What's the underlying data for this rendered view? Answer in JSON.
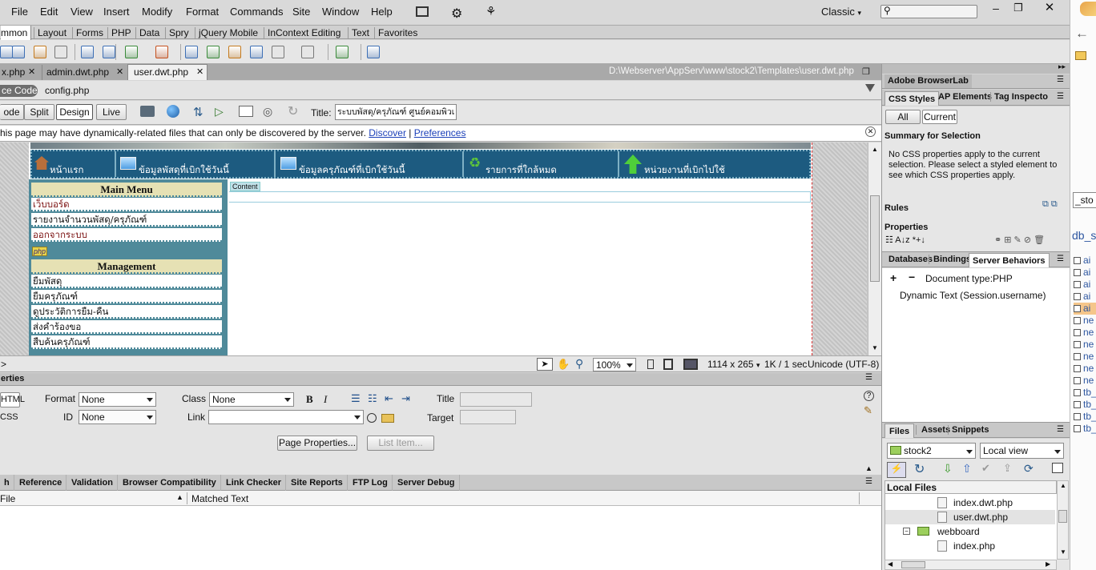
{
  "menu": [
    "File",
    "Edit",
    "View",
    "Insert",
    "Modify",
    "Format",
    "Commands",
    "Site",
    "Window",
    "Help"
  ],
  "workspace": "Classic",
  "search_placeholder": "",
  "insert_tabs": [
    "mmon",
    "Layout",
    "Forms",
    "PHP",
    "Data",
    "Spry",
    "jQuery Mobile",
    "InContext Editing",
    "Text",
    "Favorites"
  ],
  "doc_tabs": [
    "x.php",
    "admin.dwt.php",
    "user.dwt.php"
  ],
  "doc_path": "D:\\Webserver\\AppServ\\www\\stock2\\Templates\\user.dwt.php",
  "related": {
    "source_code": "ce Code",
    "file": "config.php"
  },
  "view_buttons": [
    "ode",
    "Split",
    "Design",
    "Live"
  ],
  "title_label": "Title:",
  "title_value": "ระบบพัสดุ/ครุภัณฑ์ ศูนย์คอมพิวเ",
  "info_bar": {
    "text": "his page may have dynamically-related files that can only be discovered by the server.",
    "discover": "Discover",
    "sep": "|",
    "preferences": "Preferences"
  },
  "page": {
    "nav": [
      "หน้าแรก",
      "ข้อมูลพัสดุที่เบิกใช้วันนี้",
      "ข้อมูลครุภัณฑ์ที่เบิกใช้วันนี้",
      "รายการที่ใกล้หมด",
      "หน่วยงานที่เบิกไปใช้"
    ],
    "main_menu_title": "Main Menu",
    "main_menu": [
      "เว็บบอร์ด",
      "รายงานจำนวนพัสดุ/ครุภัณฑ์",
      "ออกจากระบบ"
    ],
    "php_badge": "php",
    "management_title": "Management",
    "management": [
      "ยืมพัสดุ",
      "ยืมครุภัณฑ์",
      "ดูประวัติการยืม-คืน",
      "ส่งคำร้องขอ",
      "สืบค้นครุภัณฑ์"
    ],
    "content_label": "Content"
  },
  "status": {
    "tag": ">",
    "zoom": "100%",
    "size": "1114 x 265",
    "speed": "1K / 1 sec",
    "encoding": "Unicode (UTF-8)"
  },
  "properties": {
    "title": "erties",
    "html_btn": "HTML",
    "css_btn": "CSS",
    "format_label": "Format",
    "format_value": "None",
    "class_label": "Class",
    "class_value": "None",
    "id_label": "ID",
    "id_value": "None",
    "link_label": "Link",
    "title_label": "Title",
    "target_label": "Target",
    "page_properties": "Page Properties...",
    "list_item": "List Item..."
  },
  "results_tabs": [
    "h",
    "Reference",
    "Validation",
    "Browser Compatibility",
    "Link Checker",
    "Site Reports",
    "FTP Log",
    "Server Debug"
  ],
  "results_cols": {
    "file": "File",
    "matched": "Matched Text"
  },
  "right": {
    "browserlab": "Adobe BrowserLab",
    "css_tabs": [
      "CSS Styles",
      "AP Elements",
      "Tag Inspecto"
    ],
    "mode_buttons": [
      "All",
      "Current"
    ],
    "summary_title": "Summary for Selection",
    "summary_text": "No CSS properties apply to the current selection.  Please select a styled element to see which CSS properties apply.",
    "rules": "Rules",
    "properties": "Properties",
    "db_tabs": [
      "Databases",
      "Bindings",
      "Server Behaviors"
    ],
    "doc_type": "Document type:PHP",
    "dynamic_text": "Dynamic Text (Session.username)",
    "files_tabs": [
      "Files",
      "Assets",
      "Snippets"
    ],
    "site": "stock2",
    "view": "Local view",
    "local_files": "Local Files",
    "tree": [
      {
        "label": "index.dwt.php"
      },
      {
        "label": "user.dwt.php"
      },
      {
        "label": "webboard"
      },
      {
        "label": "index.php"
      }
    ]
  },
  "browser_edge": {
    "search_value": "_sto",
    "db_label": "db_s",
    "items": [
      "ai",
      "ai",
      "ai",
      "ai",
      "ai",
      "ne",
      "ne",
      "ne",
      "ne",
      "ne",
      "ne",
      "tb_",
      "tb_",
      "tb_",
      "tb_"
    ]
  },
  "colors": {
    "nav_bg": "#1d5b80",
    "menu_bg": "#4f8a9a",
    "head_bg": "#e6e1b4",
    "link": "#7a1010",
    "panel_tab": "#c8c8c8"
  }
}
